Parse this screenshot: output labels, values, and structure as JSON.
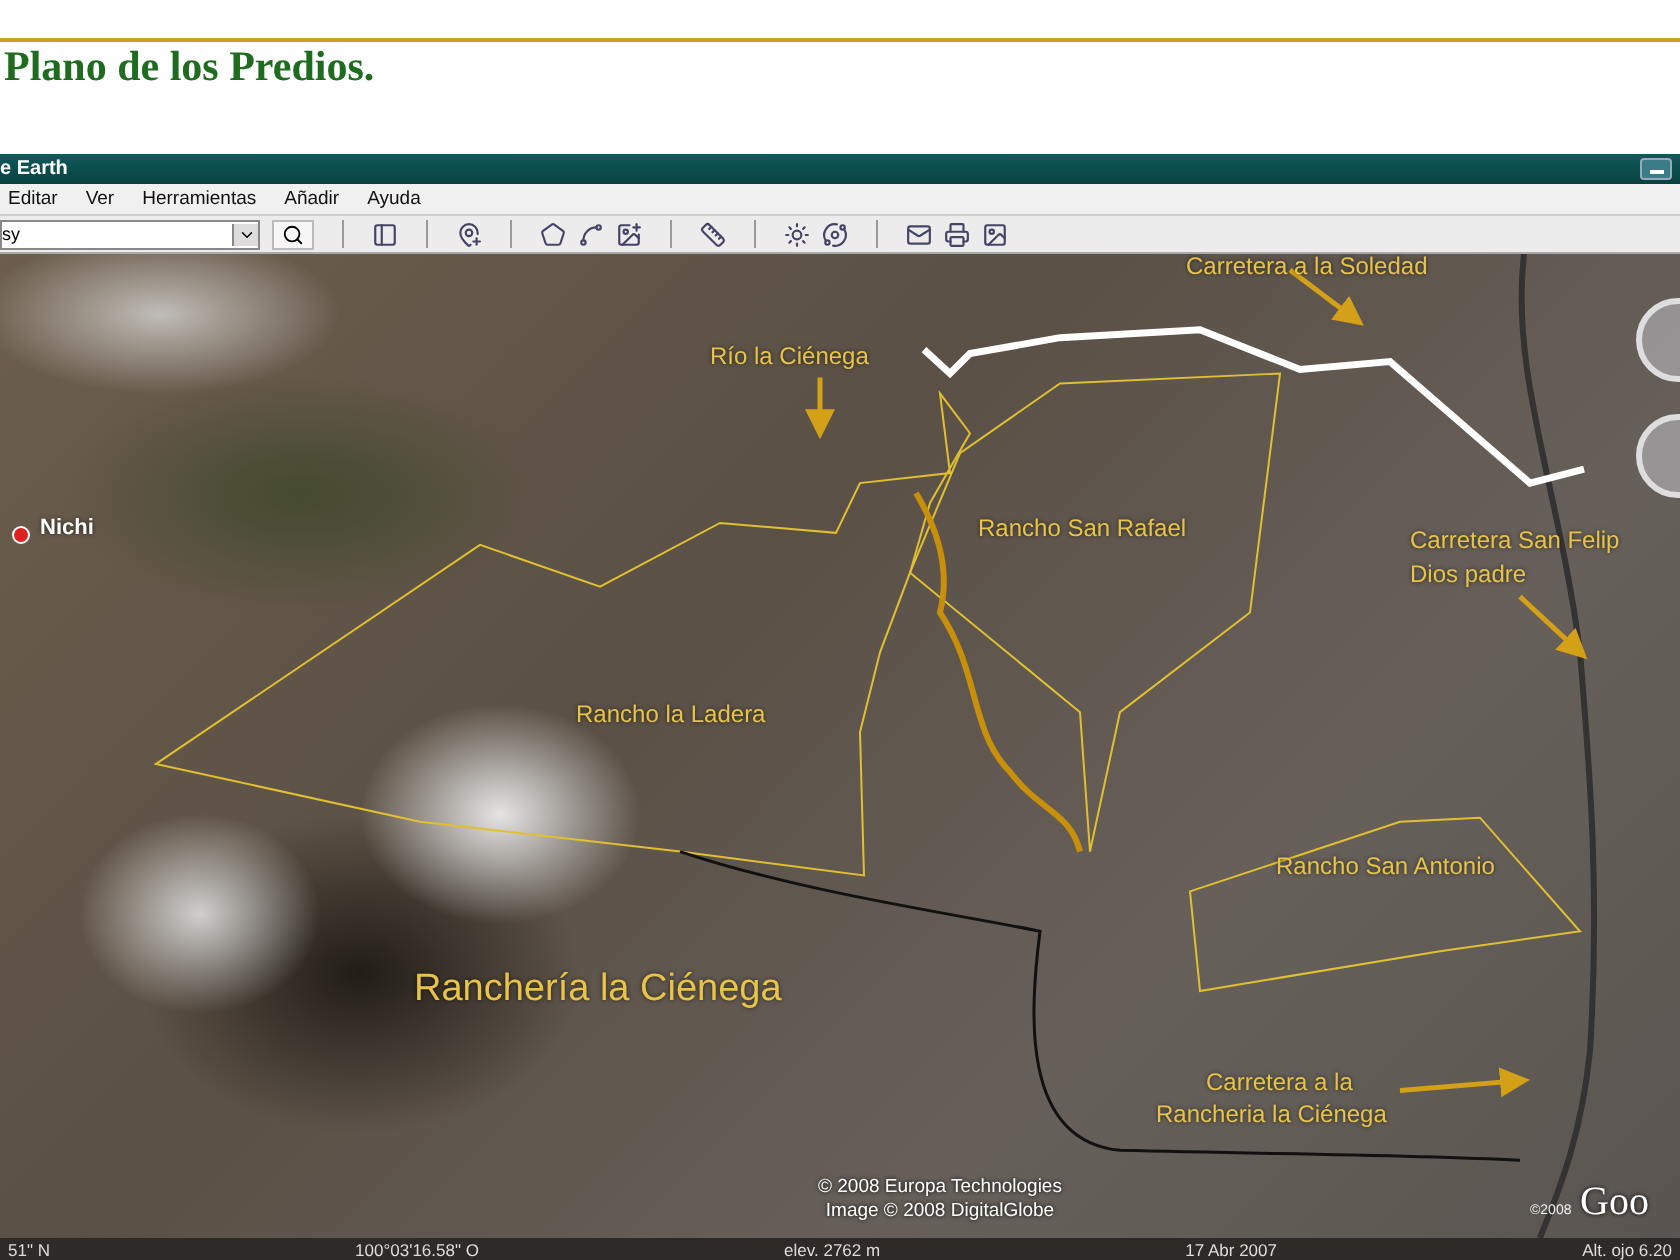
{
  "slide": {
    "title": "Plano de los Predios."
  },
  "window": {
    "title": "e Earth"
  },
  "menu": [
    "Editar",
    "Ver",
    "Herramientas",
    "Añadir",
    "Ayuda"
  ],
  "search": {
    "value": "sy"
  },
  "map": {
    "labels": [
      {
        "kind": "road",
        "text": "Carretera a la Soledad"
      },
      {
        "kind": "feature",
        "text": "Río la Ciénega"
      },
      {
        "kind": "place",
        "text": "Nichi"
      },
      {
        "kind": "feature",
        "text": "Rancho San Rafael"
      },
      {
        "kind": "road",
        "text": "Carretera San Felip"
      },
      {
        "kind": "road",
        "text": "Dios padre"
      },
      {
        "kind": "feature",
        "text": "Rancho la Ladera"
      },
      {
        "kind": "feature",
        "text": "Rancho San Antonio"
      },
      {
        "kind": "large",
        "text": "Ranchería la Ciénega"
      },
      {
        "kind": "road",
        "text": "Carretera a la"
      },
      {
        "kind": "road",
        "text": "Rancheria la Ciénega"
      }
    ],
    "attribution": [
      "© 2008 Europa Technologies",
      "Image © 2008 DigitalGlobe"
    ],
    "logo": {
      "copyright": "©2008",
      "text": "Goo"
    }
  },
  "status_bar": [
    "51\" N",
    "100°03'16.58\" O",
    "elev. 2762 m",
    "17 Abr 2007",
    "Alt. ojo 6.20"
  ]
}
